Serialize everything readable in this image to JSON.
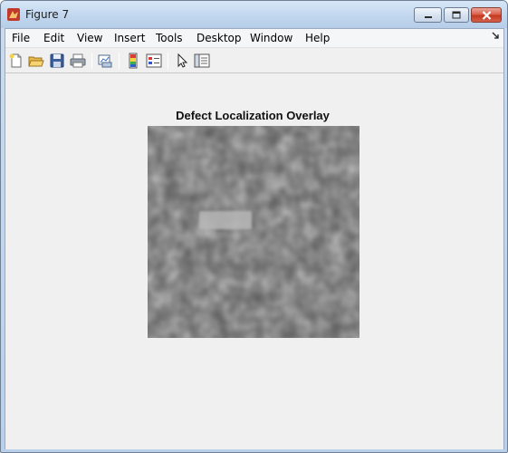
{
  "window": {
    "title": "Figure 7",
    "controls": {
      "minimize": "minimize",
      "maximize": "maximize",
      "close": "close"
    }
  },
  "menubar": {
    "items": [
      "File",
      "Edit",
      "View",
      "Insert",
      "Tools",
      "Desktop",
      "Window",
      "Help"
    ],
    "overflow_icon": "dock-arrow-icon"
  },
  "toolbar": {
    "icons": [
      "new-figure-icon",
      "open-file-icon",
      "save-icon",
      "print-icon",
      "link-plot-icon",
      "insert-colorbar-icon",
      "insert-legend-icon",
      "pointer-icon",
      "property-inspector-icon"
    ]
  },
  "figure": {
    "title": "Defect Localization Overlay",
    "image_type": "grayscale texture with a lighter rectangular defect overlay"
  }
}
